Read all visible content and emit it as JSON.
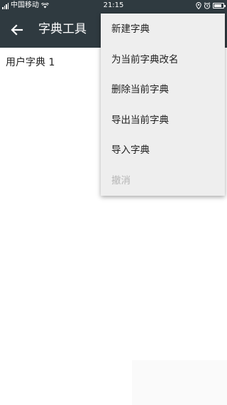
{
  "status_bar": {
    "carrier": "中国移动",
    "time": "21:15",
    "battery_level": 0.8
  },
  "toolbar": {
    "title": "字典工具",
    "back_icon": "arrow-back-icon"
  },
  "dictionaries": [
    {
      "label": "用户字典 1"
    }
  ],
  "menu": {
    "items": [
      {
        "label": "新建字典",
        "enabled": true
      },
      {
        "label": "为当前字典改名",
        "enabled": true
      },
      {
        "label": "删除当前字典",
        "enabled": true
      },
      {
        "label": "导出当前字典",
        "enabled": true
      },
      {
        "label": "导入字典",
        "enabled": true
      },
      {
        "label": "撤消",
        "enabled": false
      }
    ]
  },
  "colors": {
    "toolbar": "#2f3a40",
    "menu_background": "#eeeeee",
    "disabled_text": "#b6b6b6"
  }
}
